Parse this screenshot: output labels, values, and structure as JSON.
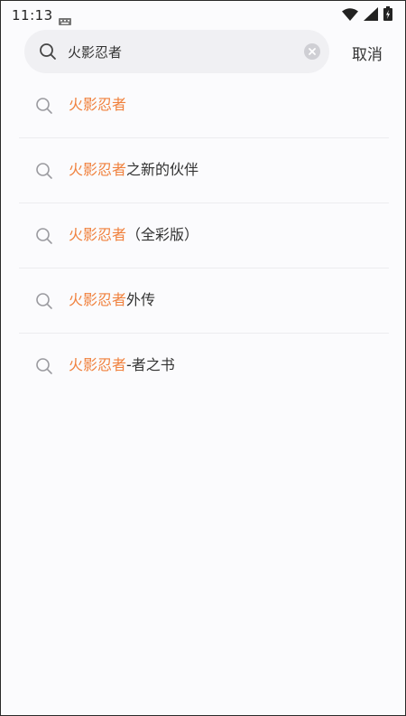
{
  "status_bar": {
    "time": "11:13"
  },
  "search": {
    "query": "火影忍者",
    "cancel_label": "取消"
  },
  "colors": {
    "highlight": "#f0803c",
    "text": "#333333",
    "icon": "#9a9a9f"
  },
  "suggestions": [
    {
      "highlight": "火影忍者",
      "rest": ""
    },
    {
      "highlight": "火影忍者",
      "rest": "之新的伙伴"
    },
    {
      "highlight": "火影忍者",
      "rest": "（全彩版）"
    },
    {
      "highlight": "火影忍者",
      "rest": "外传"
    },
    {
      "highlight": "火影忍者",
      "rest": "-者之书"
    }
  ]
}
